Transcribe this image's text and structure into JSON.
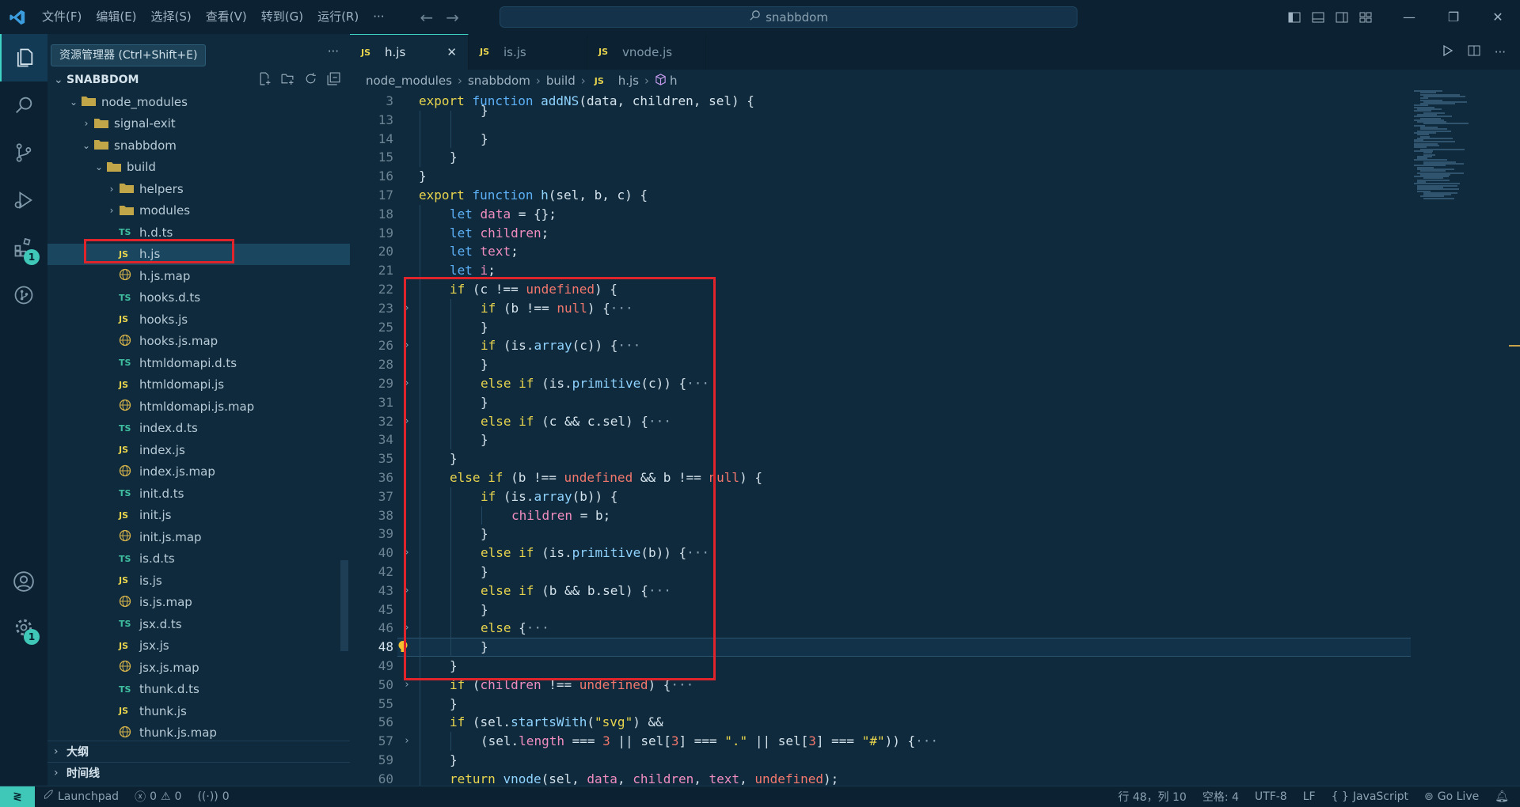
{
  "menu": [
    "文件(F)",
    "编辑(E)",
    "选择(S)",
    "查看(V)",
    "转到(G)",
    "运行(R)",
    "···"
  ],
  "search": {
    "text": "snabbdom"
  },
  "tooltip": "资源管理器 (Ctrl+Shift+E)",
  "sidebar": {
    "more": "···",
    "root_label": "SNABBDOM",
    "tree": [
      {
        "label": "node_modules",
        "kind": "folder-open",
        "level": 1,
        "chev": "⌄"
      },
      {
        "label": "signal-exit",
        "kind": "folder",
        "level": 2,
        "chev": "›"
      },
      {
        "label": "snabbdom",
        "kind": "folder-open",
        "level": 2,
        "chev": "⌄"
      },
      {
        "label": "build",
        "kind": "folder-open",
        "level": 3,
        "chev": "⌄"
      },
      {
        "label": "helpers",
        "kind": "folder",
        "level": 4,
        "chev": "›"
      },
      {
        "label": "modules",
        "kind": "folder",
        "level": 4,
        "chev": "›"
      },
      {
        "label": "h.d.ts",
        "kind": "ts",
        "level": 4
      },
      {
        "label": "h.js",
        "kind": "js",
        "level": 4,
        "selected": true
      },
      {
        "label": "h.js.map",
        "kind": "map",
        "level": 4
      },
      {
        "label": "hooks.d.ts",
        "kind": "ts",
        "level": 4
      },
      {
        "label": "hooks.js",
        "kind": "js",
        "level": 4
      },
      {
        "label": "hooks.js.map",
        "kind": "map",
        "level": 4
      },
      {
        "label": "htmldomapi.d.ts",
        "kind": "ts",
        "level": 4
      },
      {
        "label": "htmldomapi.js",
        "kind": "js",
        "level": 4
      },
      {
        "label": "htmldomapi.js.map",
        "kind": "map",
        "level": 4
      },
      {
        "label": "index.d.ts",
        "kind": "ts",
        "level": 4
      },
      {
        "label": "index.js",
        "kind": "js",
        "level": 4
      },
      {
        "label": "index.js.map",
        "kind": "map",
        "level": 4
      },
      {
        "label": "init.d.ts",
        "kind": "ts",
        "level": 4
      },
      {
        "label": "init.js",
        "kind": "js",
        "level": 4
      },
      {
        "label": "init.js.map",
        "kind": "map",
        "level": 4
      },
      {
        "label": "is.d.ts",
        "kind": "ts",
        "level": 4
      },
      {
        "label": "is.js",
        "kind": "js",
        "level": 4
      },
      {
        "label": "is.js.map",
        "kind": "map",
        "level": 4
      },
      {
        "label": "jsx.d.ts",
        "kind": "ts",
        "level": 4
      },
      {
        "label": "jsx.js",
        "kind": "js",
        "level": 4
      },
      {
        "label": "jsx.js.map",
        "kind": "map",
        "level": 4
      },
      {
        "label": "thunk.d.ts",
        "kind": "ts",
        "level": 4
      },
      {
        "label": "thunk.js",
        "kind": "js",
        "level": 4
      },
      {
        "label": "thunk.js.map",
        "kind": "map",
        "level": 4
      }
    ],
    "outline_label": "大纲",
    "timeline_label": "时间线"
  },
  "icons": {
    "ts": "TS",
    "js": "JS"
  },
  "badges": {
    "extensions": "1",
    "accounts": "1"
  },
  "tabs": [
    {
      "label": "h.js",
      "active": true,
      "close": "✕"
    },
    {
      "label": "is.js"
    },
    {
      "label": "vnode.js"
    }
  ],
  "breadcrumb": [
    "node_modules",
    "snabbdom",
    "build",
    "h.js",
    "h"
  ],
  "code": [
    {
      "n": "3",
      "fold": false,
      "ind": 0,
      "t": [
        [
          "kw2",
          "export"
        ],
        [
          "p",
          " "
        ],
        [
          "kw",
          "function"
        ],
        [
          "p",
          " "
        ],
        [
          "fn",
          "addNS"
        ],
        [
          "p",
          "(data, children, sel) {"
        ]
      ]
    },
    {
      "n": "13",
      "ind": 2,
      "t": [
        [
          "p",
          "}"
        ]
      ],
      "partial": true
    },
    {
      "n": "14",
      "ind": 2,
      "t": [
        [
          "p",
          "}"
        ]
      ]
    },
    {
      "n": "15",
      "ind": 1,
      "t": [
        [
          "p",
          "}"
        ]
      ]
    },
    {
      "n": "16",
      "ind": 0,
      "t": [
        [
          "p",
          "}"
        ]
      ]
    },
    {
      "n": "17",
      "ind": 0,
      "t": [
        [
          "kw2",
          "export"
        ],
        [
          "p",
          " "
        ],
        [
          "kw",
          "function"
        ],
        [
          "p",
          " "
        ],
        [
          "fn",
          "h"
        ],
        [
          "p",
          "(sel, b, c) {"
        ]
      ]
    },
    {
      "n": "18",
      "ind": 1,
      "t": [
        [
          "kw",
          "let"
        ],
        [
          "p",
          " "
        ],
        [
          "vr",
          "data"
        ],
        [
          "p",
          " = {};"
        ]
      ]
    },
    {
      "n": "19",
      "ind": 1,
      "t": [
        [
          "kw",
          "let"
        ],
        [
          "p",
          " "
        ],
        [
          "vr",
          "children"
        ],
        [
          "p",
          ";"
        ]
      ]
    },
    {
      "n": "20",
      "ind": 1,
      "t": [
        [
          "kw",
          "let"
        ],
        [
          "p",
          " "
        ],
        [
          "vr",
          "text"
        ],
        [
          "p",
          ";"
        ]
      ]
    },
    {
      "n": "21",
      "ind": 1,
      "t": [
        [
          "kw",
          "let"
        ],
        [
          "p",
          " "
        ],
        [
          "vr",
          "i"
        ],
        [
          "p",
          ";"
        ]
      ]
    },
    {
      "n": "22",
      "ind": 1,
      "t": [
        [
          "kw2",
          "if"
        ],
        [
          "p",
          " (c !== "
        ],
        [
          "ct",
          "undefined"
        ],
        [
          "p",
          ") {"
        ]
      ]
    },
    {
      "n": "23",
      "fold": true,
      "ind": 2,
      "t": [
        [
          "kw2",
          "if"
        ],
        [
          "p",
          " (b !== "
        ],
        [
          "ct",
          "null"
        ],
        [
          "p",
          ") {"
        ],
        [
          "el",
          "···"
        ]
      ]
    },
    {
      "n": "25",
      "ind": 2,
      "t": [
        [
          "p",
          "}"
        ]
      ]
    },
    {
      "n": "26",
      "fold": true,
      "ind": 2,
      "t": [
        [
          "kw2",
          "if"
        ],
        [
          "p",
          " (is."
        ],
        [
          "fn",
          "array"
        ],
        [
          "p",
          "(c)) {"
        ],
        [
          "el",
          "···"
        ]
      ]
    },
    {
      "n": "28",
      "ind": 2,
      "t": [
        [
          "p",
          "}"
        ]
      ]
    },
    {
      "n": "29",
      "fold": true,
      "ind": 2,
      "t": [
        [
          "kw2",
          "else if"
        ],
        [
          "p",
          " (is."
        ],
        [
          "fn",
          "primitive"
        ],
        [
          "p",
          "(c)) {"
        ],
        [
          "el",
          "···"
        ]
      ]
    },
    {
      "n": "31",
      "ind": 2,
      "t": [
        [
          "p",
          "}"
        ]
      ]
    },
    {
      "n": "32",
      "fold": true,
      "ind": 2,
      "t": [
        [
          "kw2",
          "else if"
        ],
        [
          "p",
          " (c && c.sel) {"
        ],
        [
          "el",
          "···"
        ]
      ]
    },
    {
      "n": "34",
      "ind": 2,
      "t": [
        [
          "p",
          "}"
        ]
      ]
    },
    {
      "n": "35",
      "ind": 1,
      "t": [
        [
          "p",
          "}"
        ]
      ]
    },
    {
      "n": "36",
      "ind": 1,
      "t": [
        [
          "kw2",
          "else if"
        ],
        [
          "p",
          " (b !== "
        ],
        [
          "ct",
          "undefined"
        ],
        [
          "p",
          " && b !== "
        ],
        [
          "ct",
          "null"
        ],
        [
          "p",
          ") {"
        ]
      ]
    },
    {
      "n": "37",
      "ind": 2,
      "t": [
        [
          "kw2",
          "if"
        ],
        [
          "p",
          " (is."
        ],
        [
          "fn",
          "array"
        ],
        [
          "p",
          "(b)) {"
        ]
      ]
    },
    {
      "n": "38",
      "ind": 3,
      "t": [
        [
          "vr",
          "children"
        ],
        [
          "p",
          " = b;"
        ]
      ]
    },
    {
      "n": "39",
      "ind": 2,
      "t": [
        [
          "p",
          "}"
        ]
      ]
    },
    {
      "n": "40",
      "fold": true,
      "ind": 2,
      "t": [
        [
          "kw2",
          "else if"
        ],
        [
          "p",
          " (is."
        ],
        [
          "fn",
          "primitive"
        ],
        [
          "p",
          "(b)) {"
        ],
        [
          "el",
          "···"
        ]
      ]
    },
    {
      "n": "42",
      "ind": 2,
      "t": [
        [
          "p",
          "}"
        ]
      ]
    },
    {
      "n": "43",
      "fold": true,
      "ind": 2,
      "t": [
        [
          "kw2",
          "else if"
        ],
        [
          "p",
          " (b && b.sel) {"
        ],
        [
          "el",
          "···"
        ]
      ]
    },
    {
      "n": "45",
      "ind": 2,
      "t": [
        [
          "p",
          "}"
        ]
      ]
    },
    {
      "n": "46",
      "fold": true,
      "ind": 2,
      "t": [
        [
          "kw2",
          "else"
        ],
        [
          "p",
          " {"
        ],
        [
          "el",
          "···"
        ]
      ]
    },
    {
      "n": "48",
      "ind": 2,
      "t": [
        [
          "p",
          "}"
        ]
      ],
      "active": true
    },
    {
      "n": "49",
      "ind": 1,
      "t": [
        [
          "p",
          "}"
        ]
      ]
    },
    {
      "n": "50",
      "fold": true,
      "ind": 1,
      "t": [
        [
          "kw2",
          "if"
        ],
        [
          "p",
          " ("
        ],
        [
          "vr",
          "children"
        ],
        [
          "p",
          " !== "
        ],
        [
          "ct",
          "undefined"
        ],
        [
          "p",
          ") {"
        ],
        [
          "el",
          "···"
        ]
      ]
    },
    {
      "n": "55",
      "ind": 1,
      "t": [
        [
          "p",
          "}"
        ]
      ]
    },
    {
      "n": "56",
      "ind": 1,
      "t": [
        [
          "kw2",
          "if"
        ],
        [
          "p",
          " (sel."
        ],
        [
          "fn",
          "startsWith"
        ],
        [
          "p",
          "("
        ],
        [
          "str",
          "\"svg\""
        ],
        [
          "p",
          ") &&"
        ]
      ]
    },
    {
      "n": "57",
      "fold": true,
      "ind": 2,
      "t": [
        [
          "p",
          "(sel."
        ],
        [
          "vr",
          "length"
        ],
        [
          "p",
          " === "
        ],
        [
          "ct",
          "3"
        ],
        [
          "p",
          " || sel["
        ],
        [
          "ct",
          "3"
        ],
        [
          "p",
          "] === "
        ],
        [
          "str",
          "\".\""
        ],
        [
          "p",
          " || sel["
        ],
        [
          "ct",
          "3"
        ],
        [
          "p",
          "] === "
        ],
        [
          "str",
          "\"#\""
        ],
        [
          "p",
          ")) {"
        ],
        [
          "el",
          "···"
        ]
      ]
    },
    {
      "n": "59",
      "ind": 1,
      "t": [
        [
          "p",
          "}"
        ]
      ]
    },
    {
      "n": "60",
      "ind": 1,
      "t": [
        [
          "kw2",
          "return"
        ],
        [
          "p",
          " "
        ],
        [
          "fn",
          "vnode"
        ],
        [
          "p",
          "(sel, "
        ],
        [
          "vr",
          "data"
        ],
        [
          "p",
          ", "
        ],
        [
          "vr",
          "children"
        ],
        [
          "p",
          ", "
        ],
        [
          "vr",
          "text"
        ],
        [
          "p",
          ", "
        ],
        [
          "ct",
          "undefined"
        ],
        [
          "p",
          ");"
        ]
      ]
    },
    {
      "n": "61",
      "ind": 0,
      "t": [
        [
          "p",
          "}"
        ]
      ],
      "partial": true
    }
  ],
  "status": {
    "remote_icon": "≷",
    "launchpad": "Launchpad",
    "errors": "0",
    "warnings": "0",
    "ports": "0",
    "position": "行 48，列 10",
    "spaces": "空格: 4",
    "encoding": "UTF-8",
    "eol": "LF",
    "language_icon": "{ }",
    "language": "JavaScript",
    "golive": "Go Live"
  },
  "colors": {
    "accent": "#3fd3c6",
    "highlight_box": "#e0242b",
    "bg": "#0f2a3d"
  }
}
